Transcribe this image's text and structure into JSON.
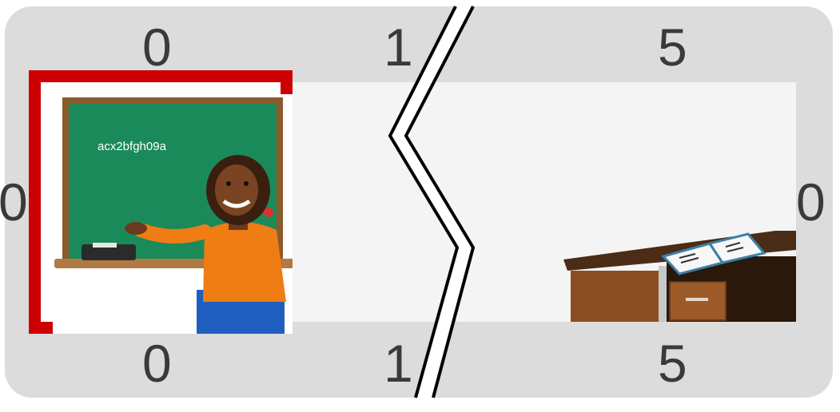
{
  "game": {
    "top_labels": [
      "0",
      "1",
      "5"
    ],
    "bottom_labels": [
      "0",
      "1",
      "5"
    ],
    "left_label": "0",
    "right_label": "0",
    "selected_cell": {
      "code": "acx2bfgh09a",
      "border_color": "#cc0000",
      "scene": "teacher-at-chalkboard"
    },
    "end_object": "desk-with-open-book",
    "colors": {
      "board": "#dcdcdc",
      "strip": "#f4f4f4",
      "chalkboard": "#1b8a5a",
      "frame_wood": "#8b5a2b"
    }
  }
}
